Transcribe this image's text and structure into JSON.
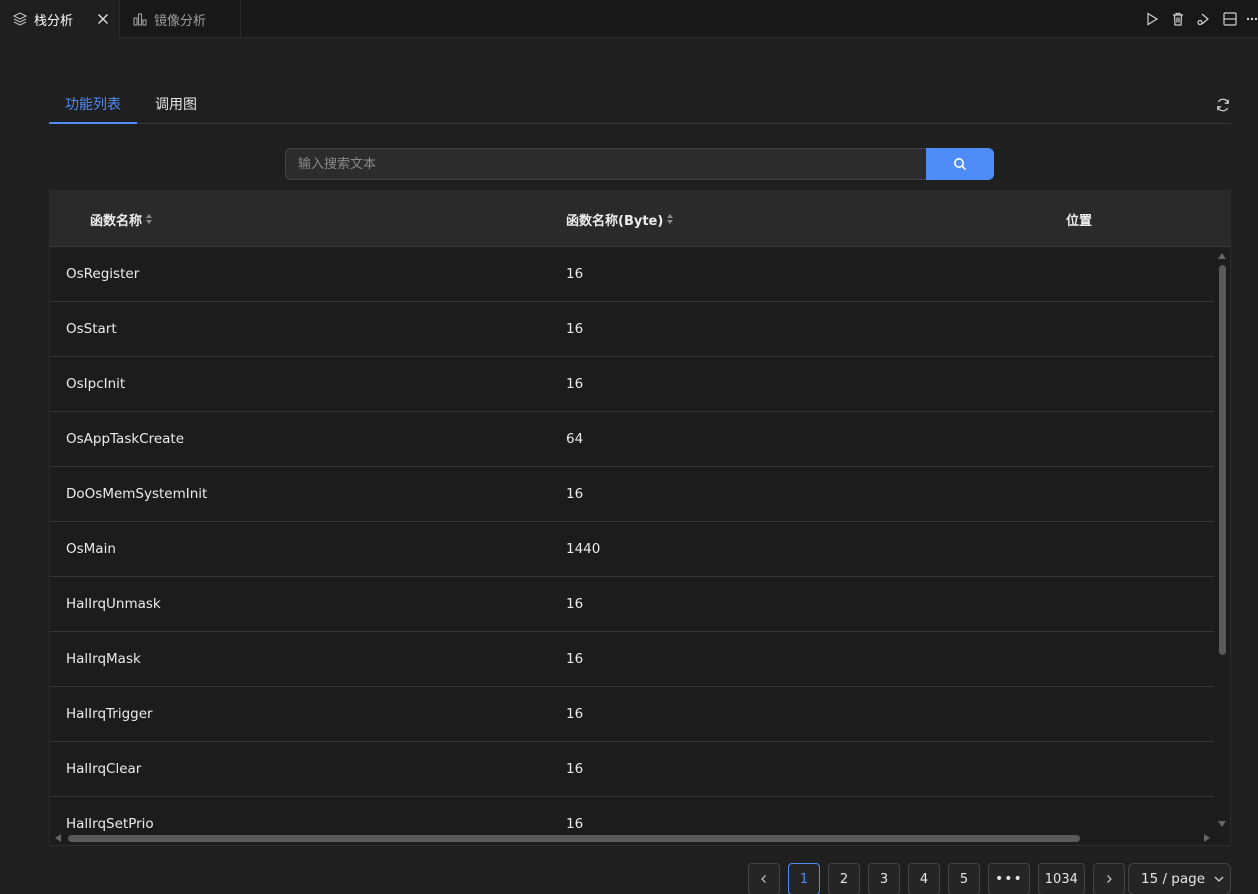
{
  "editor_tabs": [
    {
      "label": "栈分析",
      "icon": "layers-icon",
      "active": true
    },
    {
      "label": "镜像分析",
      "icon": "bar-chart-icon",
      "active": false
    }
  ],
  "editor_actions": [
    "run-icon",
    "trash-icon",
    "open-changes-icon",
    "split-editor-icon",
    "more-icon"
  ],
  "sub_tabs": [
    {
      "label": "功能列表",
      "active": true
    },
    {
      "label": "调用图",
      "active": false
    }
  ],
  "search": {
    "placeholder": "输入搜索文本",
    "value": ""
  },
  "table": {
    "columns": [
      "函数名称",
      "函数名称(Byte)",
      "位置"
    ],
    "rows": [
      {
        "name": "OsRegister",
        "size": "16",
        "location": ""
      },
      {
        "name": "OsStart",
        "size": "16",
        "location": ""
      },
      {
        "name": "OsIpcInit",
        "size": "16",
        "location": ""
      },
      {
        "name": "OsAppTaskCreate",
        "size": "64",
        "location": ""
      },
      {
        "name": "DoOsMemSystemInit",
        "size": "16",
        "location": ""
      },
      {
        "name": "OsMain",
        "size": "1440",
        "location": ""
      },
      {
        "name": "HalIrqUnmask",
        "size": "16",
        "location": ""
      },
      {
        "name": "HalIrqMask",
        "size": "16",
        "location": ""
      },
      {
        "name": "HalIrqTrigger",
        "size": "16",
        "location": ""
      },
      {
        "name": "HalIrqClear",
        "size": "16",
        "location": ""
      },
      {
        "name": "HalIrqSetPrio",
        "size": "16",
        "location": ""
      }
    ]
  },
  "pagination": {
    "prev": "<",
    "next": ">",
    "pages": [
      "1",
      "2",
      "3",
      "4",
      "5"
    ],
    "current": "1",
    "ellipsis": "•••",
    "last": "1034",
    "page_size": "15 / page"
  },
  "colors": {
    "accent": "#4f8cf7",
    "background": "#1f1f1f",
    "header": "#2a2a2a"
  }
}
